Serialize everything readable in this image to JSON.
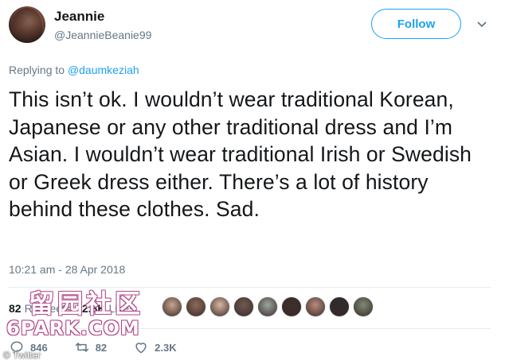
{
  "author": {
    "name": "Jeannie",
    "handle": "@JeannieBeanie99"
  },
  "follow_button": {
    "label": "Follow"
  },
  "replying": {
    "prefix": "Replying to",
    "mention": "@daumkeziah"
  },
  "tweet": {
    "text": "This isn’t ok. I wouldn’t wear traditional Korean, Japanese or any other traditional dress and I’m Asian. I wouldn’t wear traditional Irish or Swedish or Greek dress either. There’s a lot of history behind these clothes. Sad.",
    "timestamp": "10:21 am - 28 Apr 2018"
  },
  "stats": {
    "retweets_count": "82",
    "retweets_label": "Retweets",
    "likes_count": "2.3K",
    "likes_label": "Likes",
    "liker_avatar_colors": [
      "#c8a48e",
      "#8c6a5a",
      "#d9b8a3",
      "#6e5a52",
      "#9aa7a0",
      "#3d2f2b",
      "#b98c7c",
      "#2c2c2c",
      "#7d8a72"
    ]
  },
  "actions": {
    "replies": "846",
    "retweets": "82",
    "likes": "2.3K"
  },
  "watermark": {
    "chinese": "留园社区",
    "english": "6PARK.COM"
  },
  "credit": "© Twitter",
  "colors": {
    "accent": "#1da1f2",
    "muted": "#657786",
    "text": "#14171a",
    "divider": "#e6ecf0"
  },
  "icons": {
    "caret": "chevron-down-icon",
    "reply": "reply-icon",
    "retweet": "retweet-icon",
    "like": "heart-icon"
  }
}
